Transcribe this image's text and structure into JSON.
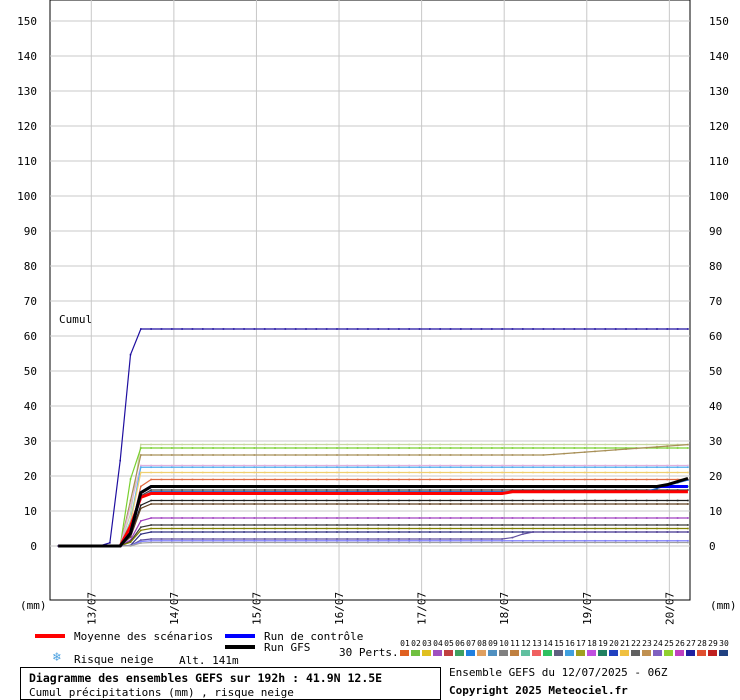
{
  "chart_data": {
    "type": "line",
    "title": "Diagramme des ensembles GEFS sur 192h : 41.9N 12.5E",
    "subtitle": "Cumul précipitations (mm) , risque neige",
    "y_axis_label": "(mm)",
    "x_axis_label": "(mm)",
    "inner_label": "Cumul",
    "ylim": [
      0,
      155
    ],
    "yticks": [
      0,
      10,
      20,
      30,
      40,
      50,
      60,
      70,
      80,
      90,
      100,
      110,
      120,
      130,
      140,
      150
    ],
    "x_tick_labels": [
      "13/07",
      "14/07",
      "15/07",
      "16/07",
      "17/07",
      "18/07",
      "19/07",
      "20/07"
    ],
    "x_tick_positions_days": [
      0.5,
      1.5,
      2.5,
      3.5,
      4.5,
      5.5,
      6.5,
      7.5
    ],
    "x_range_days": [
      0.0,
      7.75
    ],
    "grid": true,
    "members": [
      {
        "color": "#1f0fa0",
        "final": 62,
        "jump_start": 0.7,
        "jump_end": 1.05,
        "late": null
      },
      {
        "color": "#c8d8a0",
        "final": 29,
        "jump_start": 0.9,
        "jump_end": 1.1,
        "late": null
      },
      {
        "color": "#7ad030",
        "final": 28,
        "jump_start": 0.85,
        "jump_end": 1.05,
        "late": null
      },
      {
        "color": "#a89058",
        "final": 26,
        "jump_start": 0.85,
        "jump_end": 1.1,
        "late": [
          6.0,
          26,
          7.75,
          29
        ]
      },
      {
        "color": "#e0b0e0",
        "final": 23,
        "jump_start": 0.85,
        "jump_end": 1.1,
        "late": null
      },
      {
        "color": "#50b0f0",
        "final": 22.5,
        "jump_start": 0.9,
        "jump_end": 1.1,
        "late": null
      },
      {
        "color": "#f0d070",
        "final": 21,
        "jump_start": 0.9,
        "jump_end": 1.1,
        "late": null
      },
      {
        "color": "#e06840",
        "final": 19,
        "jump_start": 0.9,
        "jump_end": 1.15,
        "late": null
      },
      {
        "color": "#30c080",
        "final": 17,
        "jump_start": 0.9,
        "jump_end": 1.15,
        "late": null
      },
      {
        "color": "#404040",
        "final": 16,
        "jump_start": 0.9,
        "jump_end": 1.15,
        "late": null
      },
      {
        "color": "#2060c0",
        "final": 15.5,
        "jump_start": 0.9,
        "jump_end": 1.15,
        "late": [
          7.2,
          15.5,
          7.75,
          19
        ]
      },
      {
        "color": "#202020",
        "final": 13,
        "jump_start": 0.9,
        "jump_end": 1.15,
        "late": null
      },
      {
        "color": "#604020",
        "final": 12,
        "jump_start": 0.9,
        "jump_end": 1.15,
        "late": null
      },
      {
        "color": "#a040c0",
        "final": 8,
        "jump_start": 0.9,
        "jump_end": 1.15,
        "late": null
      },
      {
        "color": "#3a3a3a",
        "final": 6,
        "jump_start": 0.9,
        "jump_end": 1.15,
        "late": null
      },
      {
        "color": "#808000",
        "final": 5,
        "jump_start": 0.9,
        "jump_end": 1.15,
        "late": null
      },
      {
        "color": "#303080",
        "final": 4,
        "jump_start": 0.95,
        "jump_end": 1.15,
        "late": null
      },
      {
        "color": "#6050a0",
        "final": 2,
        "jump_start": 0.95,
        "jump_end": 1.15,
        "late": [
          5.55,
          2,
          5.8,
          4
        ]
      },
      {
        "color": "#8080ff",
        "final": 1.5,
        "jump_start": 0.95,
        "jump_end": 1.15,
        "late": null
      },
      {
        "color": "#a0a0a0",
        "final": 1,
        "jump_start": 0.95,
        "jump_end": 1.15,
        "late": null
      }
    ],
    "series": [
      {
        "name": "Moyenne des scénarios",
        "color": "#ff0000",
        "final": 15,
        "jump_start": 0.85,
        "jump_end": 1.15,
        "late": [
          5.5,
          15,
          5.55,
          15.5
        ]
      },
      {
        "name": "Run de contrôle",
        "color": "#0000ff",
        "final": 17,
        "jump_start": 0.9,
        "jump_end": 1.15,
        "late": [
          7.3,
          17,
          7.75,
          17
        ]
      },
      {
        "name": "Run GFS",
        "color": "#000000",
        "final": 17,
        "jump_start": 0.9,
        "jump_end": 1.15,
        "late": [
          7.4,
          17,
          7.75,
          19.5
        ]
      }
    ]
  },
  "legend": {
    "mean_label": "Moyenne des scénarios",
    "control_label": "Run de contrôle",
    "gfs_label": "Run GFS",
    "snow_label": "Risque neige",
    "alt_label": "Alt. 141m",
    "perts_label": "30 Perts.",
    "snow_icon": "snowflake-icon"
  },
  "perturbations": {
    "numbers": [
      "01",
      "02",
      "03",
      "04",
      "05",
      "06",
      "07",
      "08",
      "09",
      "10",
      "11",
      "12",
      "13",
      "14",
      "15",
      "16",
      "17",
      "18",
      "19",
      "20",
      "21",
      "22",
      "23",
      "24",
      "25",
      "26",
      "27",
      "28",
      "29",
      "30"
    ],
    "colors": [
      "#e06020",
      "#70c040",
      "#e0c020",
      "#a050c0",
      "#c04040",
      "#40a060",
      "#2080e0",
      "#e0a060",
      "#5090c0",
      "#808080",
      "#c08040",
      "#60c0a0",
      "#f06060",
      "#30c060",
      "#606080",
      "#40a0e0",
      "#a0a020",
      "#c050e0",
      "#208060",
      "#2040c0",
      "#f0c040",
      "#606060",
      "#c09050",
      "#8060c0",
      "#90d030",
      "#c040c0",
      "#2020a0",
      "#e05030",
      "#c02020",
      "#204080"
    ]
  },
  "footer": {
    "run_info": "Ensemble GEFS du 12/07/2025 - 06Z",
    "copyright": "Copyright 2025 Meteociel.fr"
  }
}
